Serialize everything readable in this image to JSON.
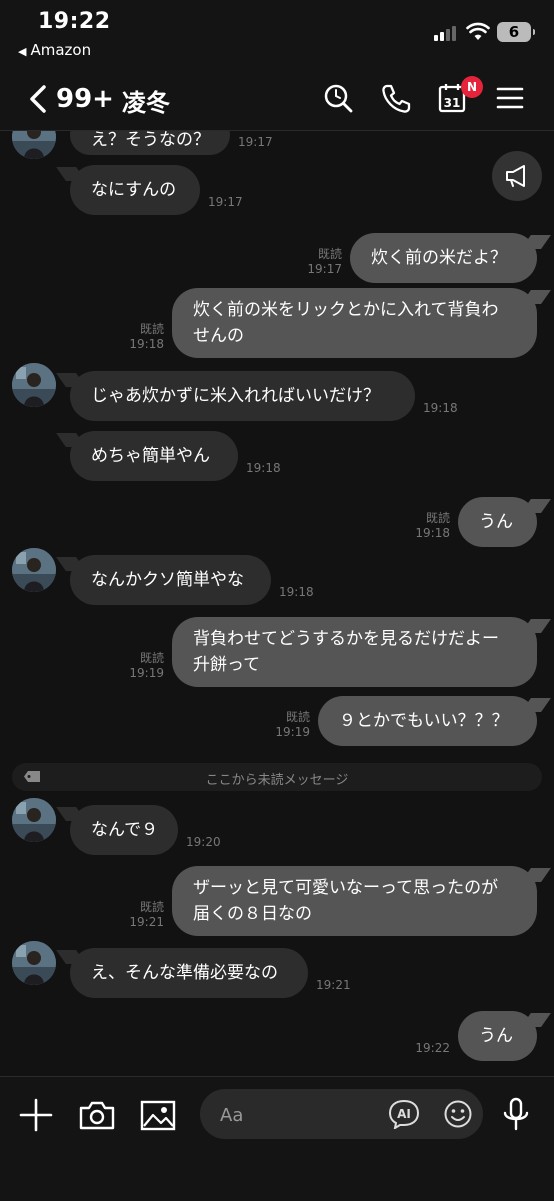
{
  "status": {
    "time": "19:22",
    "back_app": "Amazon",
    "battery": "6"
  },
  "header": {
    "back_count": "99+",
    "chat_name": "凌冬",
    "calendar_day": "31",
    "calendar_badge": "N"
  },
  "messages": [
    {
      "side": "in",
      "text": "え？そうなの？",
      "time": "19:17"
    },
    {
      "side": "in",
      "text": "なにすんの",
      "time": "19:17"
    },
    {
      "side": "out",
      "text": "炊く前の米だよ？",
      "read": "既読",
      "time": "19:17"
    },
    {
      "side": "out",
      "lines": [
        "炊く前の米をリックとかに入れて背負わ",
        "せんの"
      ],
      "read": "既読",
      "time": "19:18"
    },
    {
      "side": "in",
      "text": "じゃあ炊かずに米入れればいいだけ？",
      "time": "19:18"
    },
    {
      "side": "in",
      "text": "めちゃ簡単やん",
      "time": "19:18"
    },
    {
      "side": "out",
      "text": "うん",
      "read": "既読",
      "time": "19:18"
    },
    {
      "side": "in",
      "text": "なんかクソ簡単やな",
      "time": "19:18"
    },
    {
      "side": "out",
      "lines": [
        "背負わせてどうするかを見るだけだよー",
        "升餅って"
      ],
      "read": "既読",
      "time": "19:19"
    },
    {
      "side": "out",
      "text": "９とかでもいい？？？",
      "read": "既読",
      "time": "19:19"
    },
    {
      "side": "in",
      "text": "なんで９",
      "time": "19:20"
    },
    {
      "side": "out",
      "lines": [
        "ザーッと見て可愛いなーって思ったのが",
        "届くの８日なの"
      ],
      "read": "既読",
      "time": "19:21"
    },
    {
      "side": "in",
      "text": "え、そんな準備必要なの",
      "time": "19:21"
    },
    {
      "side": "out",
      "text": "うん",
      "time": "19:22"
    }
  ],
  "unread_divider": "ここから未読メッセージ",
  "composer": {
    "placeholder": "Aa",
    "ai_label": "AI"
  },
  "colors": {
    "background": "#121212",
    "incoming_bubble": "#2d2d2d",
    "outgoing_bubble": "#555555",
    "badge": "#e5243b"
  }
}
